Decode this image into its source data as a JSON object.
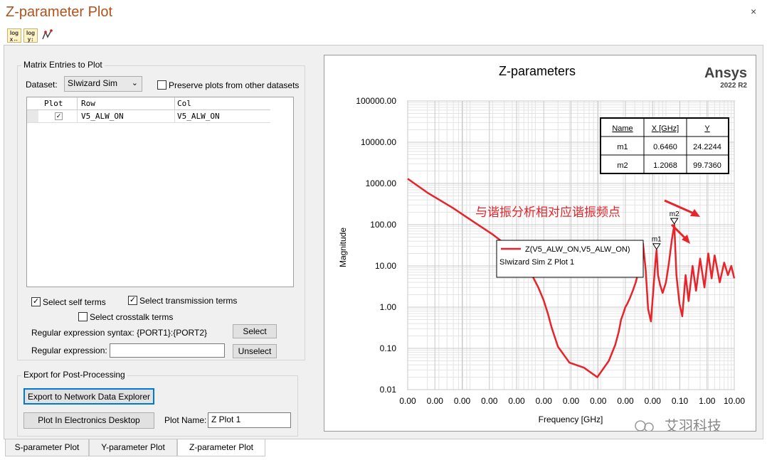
{
  "window": {
    "title": "Z-parameter Plot",
    "close_glyph": "×"
  },
  "toolbar": {
    "log_x": [
      "log",
      "x↔"
    ],
    "log_y": [
      "log",
      "y↕"
    ],
    "icon3": "marker-plot-icon"
  },
  "matrix": {
    "group_label": "Matrix Entries to Plot",
    "dataset_label": "Dataset:",
    "dataset_value": "SIwizard Sim",
    "preserve_label": "Preserve plots from other datasets",
    "headers": [
      "Plot",
      "Row",
      "Col"
    ],
    "rows": [
      {
        "plot": "✓",
        "row": "V5_ALW_ON",
        "col": "V5_ALW_ON"
      }
    ],
    "self_terms_label": "Select self terms",
    "transmission_label": "Select transmission terms",
    "crosstalk_label": "Select crosstalk terms",
    "regex_syntax_label": "Regular expression syntax: {PORT1}:{PORT2}",
    "select_button": "Select",
    "regex_label": "Regular expression:",
    "regex_value": "",
    "unselect_button": "Unselect"
  },
  "export": {
    "group_label": "Export for Post-Processing",
    "export_button": "Export to Network Data Explorer",
    "plot_button": "Plot In Electronics Desktop",
    "plot_name_label": "Plot Name:",
    "plot_name_value": "Z Plot 1"
  },
  "tabs": [
    "S-parameter Plot",
    "Y-parameter Plot",
    "Z-parameter Plot"
  ],
  "active_tab": 2,
  "plot": {
    "brand": "Ansys",
    "version": "2022 R2",
    "annotation": "与谐振分析相对应谐振频点",
    "watermark": "艾羽科技",
    "marker_table": {
      "headers": [
        "Name",
        "X [GHz]",
        "Y"
      ],
      "rows": [
        [
          "m1",
          "0.6460",
          "24.2244"
        ],
        [
          "m2",
          "1.2068",
          "99.7360"
        ]
      ]
    },
    "legend": {
      "series": "Z(V5_ALW_ON,V5_ALW_ON)",
      "subtitle": "SIwizard Sim Z Plot 1"
    },
    "colors": {
      "trace": "#e8232a",
      "annotation": "#e8232a",
      "grid_major": "#c8c8c8",
      "grid_minor": "#e4e4e4"
    }
  },
  "chart_data": {
    "type": "line",
    "title": "Z-parameters",
    "xlabel": "Frequency [GHz]",
    "ylabel": "Magnitude",
    "xscale": "log",
    "yscale": "log",
    "xlim": [
      0.0001,
      10
    ],
    "ylim": [
      0.01,
      100000
    ],
    "x_tick_labels": [
      "0.00",
      "0.00",
      "0.00",
      "0.00",
      "0.00",
      "0.00",
      "0.00",
      "0.00",
      "0.00",
      "0.00",
      "0.10",
      "1.00",
      "10.00"
    ],
    "y_tick_labels": [
      "0.01",
      "0.10",
      "1.00",
      "10.00",
      "100.00",
      "1000.00",
      "10000.00",
      "100000.00"
    ],
    "grid": true,
    "series": [
      {
        "name": "Z(V5_ALW_ON,V5_ALW_ON)",
        "x": [
          0.0001,
          0.0002,
          0.0005,
          0.001,
          0.002,
          0.004,
          0.006,
          0.008,
          0.01,
          0.012,
          0.014,
          0.016,
          0.02,
          0.03,
          0.05,
          0.08,
          0.12,
          0.15,
          0.17,
          0.185,
          0.2,
          0.215,
          0.23,
          0.25,
          0.28,
          0.31,
          0.34,
          0.37,
          0.4,
          0.44,
          0.48,
          0.53,
          0.58,
          0.62,
          0.646,
          0.68,
          0.73,
          0.8,
          0.9,
          1.0,
          1.1,
          1.2068,
          1.3,
          1.45,
          1.6,
          1.8,
          2.0,
          2.3,
          2.6,
          3.0,
          3.5,
          4.0,
          4.5,
          5.0,
          6.0,
          7.0,
          8.0,
          9.0,
          10.0
        ],
        "y": [
          1300,
          600,
          250,
          120,
          58,
          25,
          12,
          6,
          3,
          1.5,
          0.7,
          0.32,
          0.11,
          0.045,
          0.034,
          0.02,
          0.05,
          0.12,
          0.25,
          0.5,
          0.7,
          1.0,
          1.2,
          1.6,
          2.5,
          4.0,
          7.0,
          13,
          35,
          8,
          0.9,
          0.45,
          3,
          12,
          24.2244,
          6,
          3.5,
          2.2,
          4,
          12,
          40,
          99.736,
          6,
          1.2,
          0.6,
          6,
          1.4,
          10,
          2.5,
          15,
          3,
          20,
          5,
          18,
          4,
          12,
          6,
          10,
          5
        ]
      }
    ],
    "markers": [
      {
        "name": "m1",
        "x": 0.646,
        "y": 24.2244
      },
      {
        "name": "m2",
        "x": 1.2068,
        "y": 99.736
      }
    ]
  }
}
